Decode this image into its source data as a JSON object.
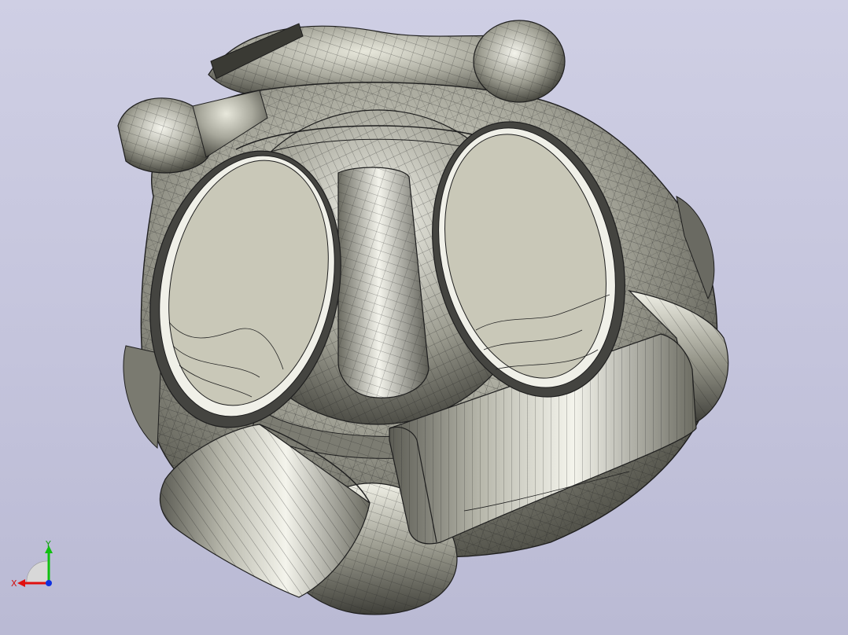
{
  "viewport": {
    "model": "respirator-mask",
    "render_style": "shaded-with-mesh-edges",
    "colors": {
      "background_top": "#cfcfe4",
      "background_bottom": "#babad4",
      "surface_light": "#f4f4ec",
      "surface_mid": "#a8a89c",
      "surface_dark": "#4a4a42",
      "filter_cap": "#c9c8b8",
      "edge": "#1e1e1e"
    }
  },
  "triad": {
    "x_label": "X",
    "y_label": "Y",
    "colors": {
      "x": "#e01010",
      "y": "#10c010",
      "z": "#1030e0"
    }
  }
}
